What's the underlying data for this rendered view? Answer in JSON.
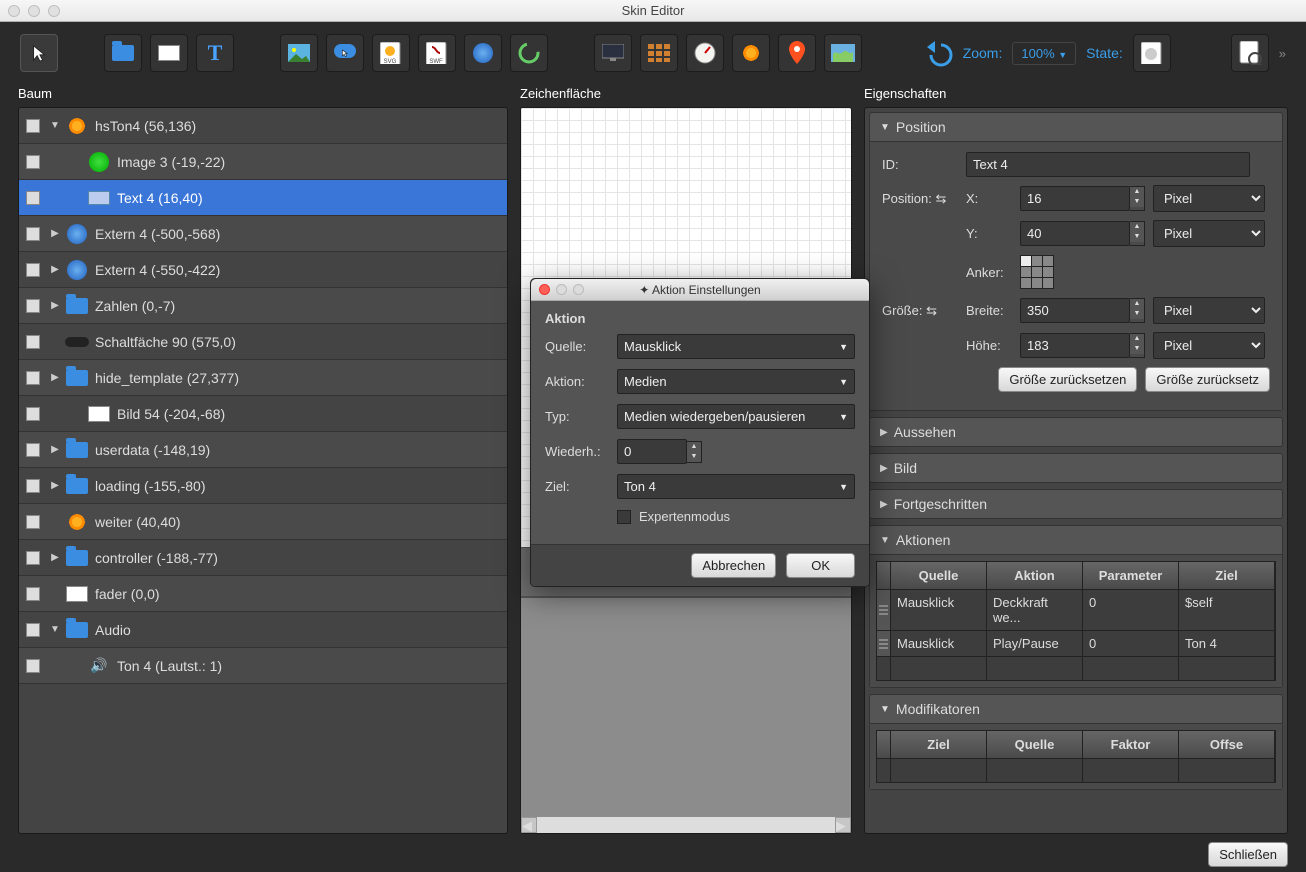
{
  "window": {
    "title": "Skin Editor"
  },
  "toolbar": {
    "zoom_label": "Zoom:",
    "zoom_value": "100%",
    "state_label": "State:"
  },
  "panels": {
    "tree_title": "Baum",
    "canvas_title": "Zeichenfläche",
    "props_title": "Eigenschaften"
  },
  "tree": [
    {
      "label": "hsTon4 (56,136)",
      "indent": 1,
      "expand": "▼",
      "icon": "target"
    },
    {
      "label": "Image 3 (-19,-22)",
      "indent": 2,
      "expand": "",
      "icon": "green"
    },
    {
      "label": "Text 4 (16,40)",
      "indent": 2,
      "expand": "",
      "icon": "text",
      "selected": true
    },
    {
      "label": "Extern 4 (-500,-568)",
      "indent": 1,
      "expand": "▶",
      "icon": "globe"
    },
    {
      "label": "Extern 4 (-550,-422)",
      "indent": 1,
      "expand": "▶",
      "icon": "globe"
    },
    {
      "label": "Zahlen (0,-7)",
      "indent": 1,
      "expand": "▶",
      "icon": "folder"
    },
    {
      "label": "Schaltfäche 90 (575,0)",
      "indent": 1,
      "expand": "",
      "icon": "btn"
    },
    {
      "label": "hide_template (27,377)",
      "indent": 1,
      "expand": "▶",
      "icon": "folder"
    },
    {
      "label": "Bild 54 (-204,-68)",
      "indent": 2,
      "expand": "",
      "icon": "rect"
    },
    {
      "label": "userdata (-148,19)",
      "indent": 1,
      "expand": "▶",
      "icon": "folder"
    },
    {
      "label": "loading (-155,-80)",
      "indent": 1,
      "expand": "▶",
      "icon": "folder"
    },
    {
      "label": "weiter (40,40)",
      "indent": 1,
      "expand": "",
      "icon": "target"
    },
    {
      "label": "controller (-188,-77)",
      "indent": 1,
      "expand": "▶",
      "icon": "folder"
    },
    {
      "label": "fader (0,0)",
      "indent": 1,
      "expand": "",
      "icon": "rect"
    },
    {
      "label": "Audio",
      "indent": 1,
      "expand": "▼",
      "icon": "folder"
    },
    {
      "label": "Ton 4 (Lautst.: 1)",
      "indent": 2,
      "expand": "",
      "icon": "sound"
    }
  ],
  "props": {
    "position_header": "Position",
    "id_label": "ID:",
    "id_value": "Text 4",
    "pos_label": "Position:",
    "x_label": "X:",
    "x_value": "16",
    "y_label": "Y:",
    "y_value": "40",
    "unit_pixel": "Pixel",
    "anker_label": "Anker:",
    "size_label": "Größe:",
    "breite_label": "Breite:",
    "breite_value": "350",
    "hohe_label": "Höhe:",
    "hohe_value": "183",
    "reset_size": "Größe zurücksetzen",
    "reset_size2": "Größe zurücksetz",
    "aussehen_header": "Aussehen",
    "bild_header": "Bild",
    "fortgeschritten_header": "Fortgeschritten",
    "aktionen_header": "Aktionen",
    "modifikatoren_header": "Modifikatoren"
  },
  "actions_table": {
    "headers": [
      "Quelle",
      "Aktion",
      "Parameter",
      "Ziel"
    ],
    "rows": [
      [
        "Mausklick",
        "Deckkraft we...",
        "0",
        "$self"
      ],
      [
        "Mausklick",
        "Play/Pause",
        "0",
        "Ton 4"
      ]
    ]
  },
  "mod_table": {
    "headers": [
      "Ziel",
      "Quelle",
      "Faktor",
      "Offse"
    ]
  },
  "dialog": {
    "title": "Aktion Einstellungen",
    "section": "Aktion",
    "quelle_label": "Quelle:",
    "quelle_value": "Mausklick",
    "aktion_label": "Aktion:",
    "aktion_value": "Medien",
    "typ_label": "Typ:",
    "typ_value": "Medien wiedergeben/pausieren",
    "wiederh_label": "Wiederh.:",
    "wiederh_value": "0",
    "ziel_label": "Ziel:",
    "ziel_value": "Ton 4",
    "expert_label": "Expertenmodus",
    "cancel": "Abbrechen",
    "ok": "OK"
  },
  "footer": {
    "close": "Schließen"
  }
}
